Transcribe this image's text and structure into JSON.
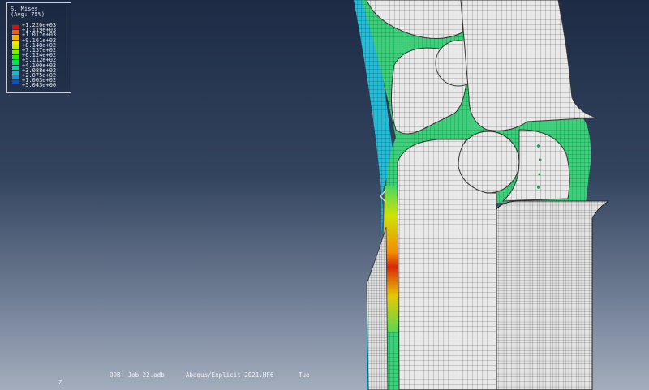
{
  "legend": {
    "title": "S, Mises",
    "subtitle": "(Avg: 75%)",
    "values": [
      "+1.220e+03",
      "+1.119e+03",
      "+1.017e+03",
      "+9.161e+02",
      "+8.148e+02",
      "+7.137e+02",
      "+6.124e+02",
      "+5.112e+02",
      "+4.100e+02",
      "+3.088e+02",
      "+2.075e+02",
      "+1.063e+02",
      "+5.043e+00"
    ],
    "colors": [
      "#ff0000",
      "#ff5a00",
      "#ffab00",
      "#f3e500",
      "#bcf000",
      "#7cf000",
      "#23f000",
      "#00e45a",
      "#00d6a0",
      "#00c4d4",
      "#0096e8",
      "#0050e6",
      "#0000c8"
    ]
  },
  "status": {
    "odb": "ODB: Job-22.odb",
    "solver": "Abaqus/Explicit 2021.HF6",
    "date": "Tue"
  },
  "axis_label": "Z",
  "colors": {
    "bg_top": "#1d2b45",
    "bg_bottom": "#a3adbd",
    "mesh_gray": "#e6e6e6",
    "mesh_green": "#35d07a",
    "mesh_cyan": "#22c3d6"
  }
}
